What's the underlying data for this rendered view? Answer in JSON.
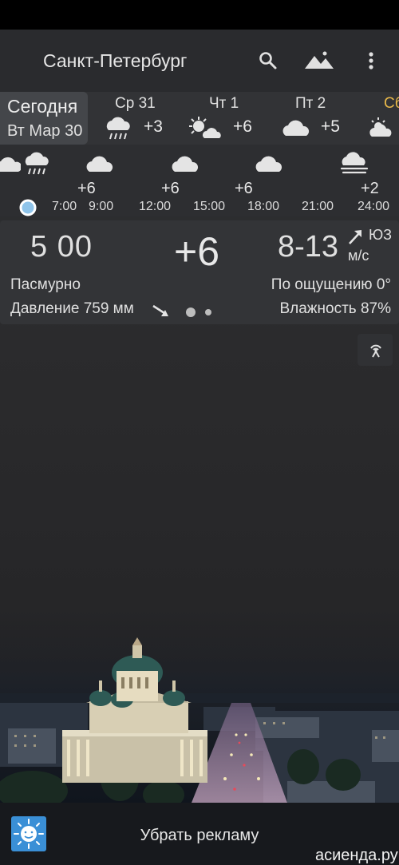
{
  "app_bar": {
    "city": "Санкт-Петербург",
    "icons": [
      "search-icon",
      "landscape-icon",
      "more-vert-icon"
    ]
  },
  "days": {
    "today": {
      "label": "Сегодня",
      "date": "Вт Мар 30"
    },
    "items": [
      {
        "label": "Ср 31",
        "temp": "+3",
        "icon": "rain-cloud-icon"
      },
      {
        "label": "Чт 1",
        "temp": "+6",
        "icon": "sun-cloud-icon"
      },
      {
        "label": "Пт 2",
        "temp": "+5",
        "icon": "cloud-icon"
      },
      {
        "label": "Сб",
        "icon": "sun-cloud-icon"
      }
    ]
  },
  "hourly": {
    "temps": [
      "+6",
      "+6",
      "+6",
      "+2"
    ],
    "times": [
      "7:00",
      "9:00",
      "12:00",
      "15:00",
      "18:00",
      "21:00",
      "24:00"
    ],
    "icons": [
      "cloud-icon",
      "rain-cloud-icon",
      "cloud-icon",
      "cloud-icon",
      "cloud-icon",
      "fog-icon"
    ]
  },
  "current": {
    "time": "5 00",
    "temp": "+6",
    "wind_speed": "8-13",
    "wind_dir": "ЮЗ",
    "wind_unit": "м/с",
    "condition": "Пасмурно",
    "feels_like": "По ощущению 0°",
    "pressure": "Давление 759 мм",
    "humidity": "Влажность 87%"
  },
  "footer": {
    "remove_ads": "Убрать рекламу",
    "watermark": "асиенда.ру"
  },
  "colors": {
    "saturday_label": "#e8b84a",
    "now_marker": "#8fc4ea",
    "app_icon_bg": "#3a8fd6"
  }
}
